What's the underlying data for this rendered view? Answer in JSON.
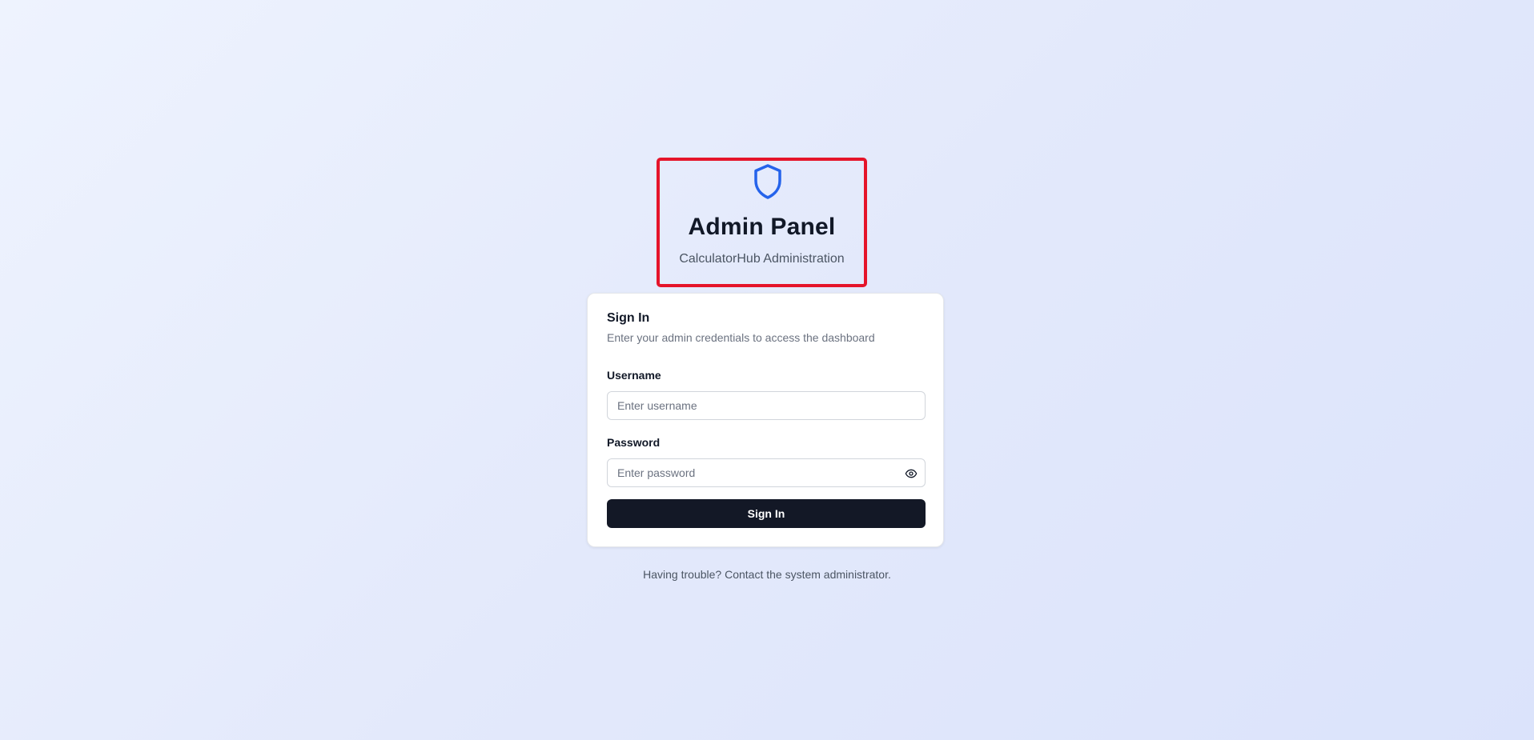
{
  "header": {
    "title": "Admin Panel",
    "subtitle": "CalculatorHub Administration",
    "icon": "shield-icon"
  },
  "card": {
    "title": "Sign In",
    "description": "Enter your admin credentials to access the dashboard",
    "username": {
      "label": "Username",
      "value": "",
      "placeholder": "Enter username"
    },
    "password": {
      "label": "Password",
      "value": "",
      "placeholder": "Enter password",
      "toggle_icon": "eye-icon"
    },
    "submit_label": "Sign In"
  },
  "footer": {
    "text": "Having trouble? Contact the system administrator."
  },
  "colors": {
    "accent": "#2563eb",
    "button": "#131826",
    "highlight_border": "#e5142a"
  }
}
